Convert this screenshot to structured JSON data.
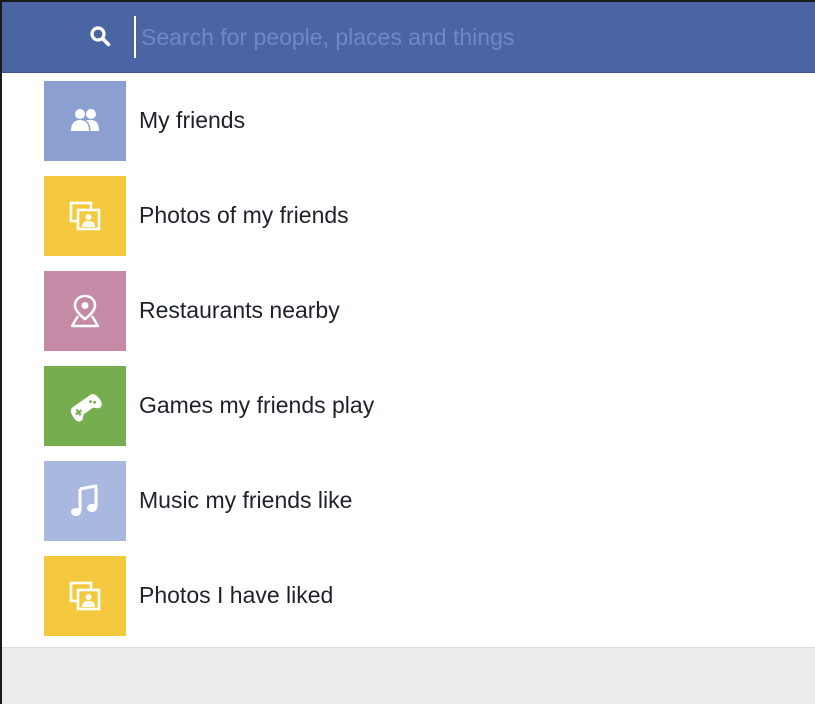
{
  "search": {
    "placeholder": "Search for people, places and things",
    "icon": "search-icon"
  },
  "colors": {
    "header": "#4965a4",
    "friends": "#8c9fd1",
    "photos": "#f5c93e",
    "places": "#c48aa6",
    "games": "#76ad4e",
    "music": "#a9b8de",
    "footer": "#ededed"
  },
  "results": [
    {
      "label": "My friends",
      "icon": "friends-icon"
    },
    {
      "label": "Photos of my friends",
      "icon": "photos-icon"
    },
    {
      "label": "Restaurants nearby",
      "icon": "map-pin-icon"
    },
    {
      "label": "Games my friends play",
      "icon": "game-controller-icon"
    },
    {
      "label": "Music my friends like",
      "icon": "music-note-icon"
    },
    {
      "label": "Photos I have liked",
      "icon": "photos-icon"
    }
  ]
}
